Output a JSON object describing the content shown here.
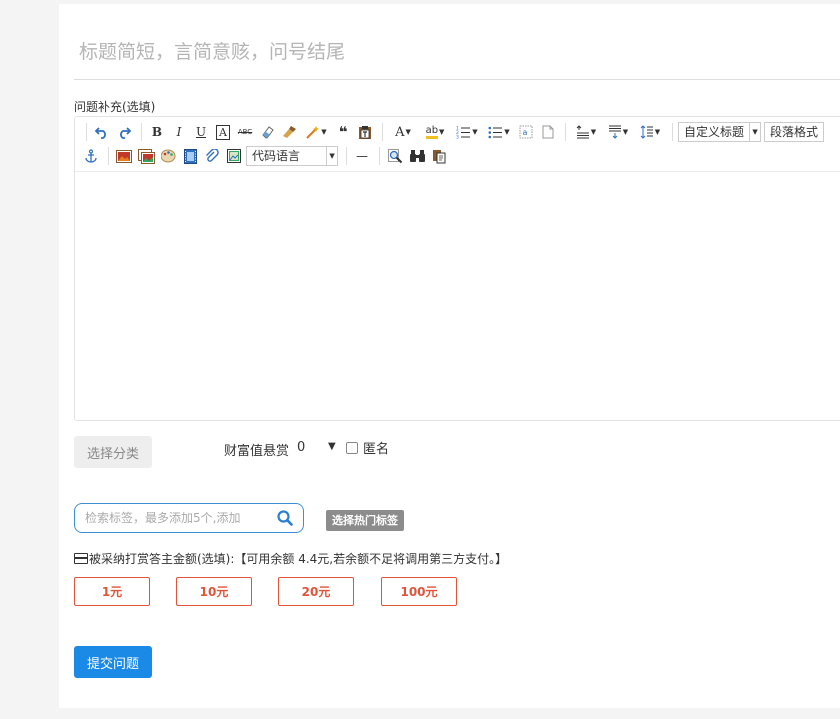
{
  "title": {
    "placeholder": "标题简短，言简意赅，问号结尾",
    "value": ""
  },
  "supplement_label": "问题补充(选填)",
  "toolbar": {
    "glyphs": {
      "bold": "B",
      "italic": "I",
      "underline": "U",
      "font_border": "A",
      "strikethrough": "ABC",
      "quote": "❝",
      "font_color": "A",
      "highlight": "ab",
      "horizontal_rule": "—"
    },
    "select_custom_title": "自定义标题",
    "select_paragraph": "段落格式",
    "select_code_language": "代码语言"
  },
  "category_button": "选择分类",
  "reward": {
    "label": "财富值悬赏",
    "value": "0",
    "arrow": "▼"
  },
  "anonymous_label": "匿名",
  "tag_search": {
    "placeholder": "检索标签，最多添加5个,添加"
  },
  "hot_tags_button": "选择热门标签",
  "reward_notice": "被采纳打赏答主金额(选填):【可用余额 4.4元,若余额不足将调用第三方支付。】",
  "amounts": [
    "1元",
    "10元",
    "20元",
    "100元"
  ],
  "submit_button": "提交问题",
  "colors": {
    "accent": "#1a8ae6",
    "amount_border": "#e0543a",
    "search_border": "#3c8fd6"
  }
}
